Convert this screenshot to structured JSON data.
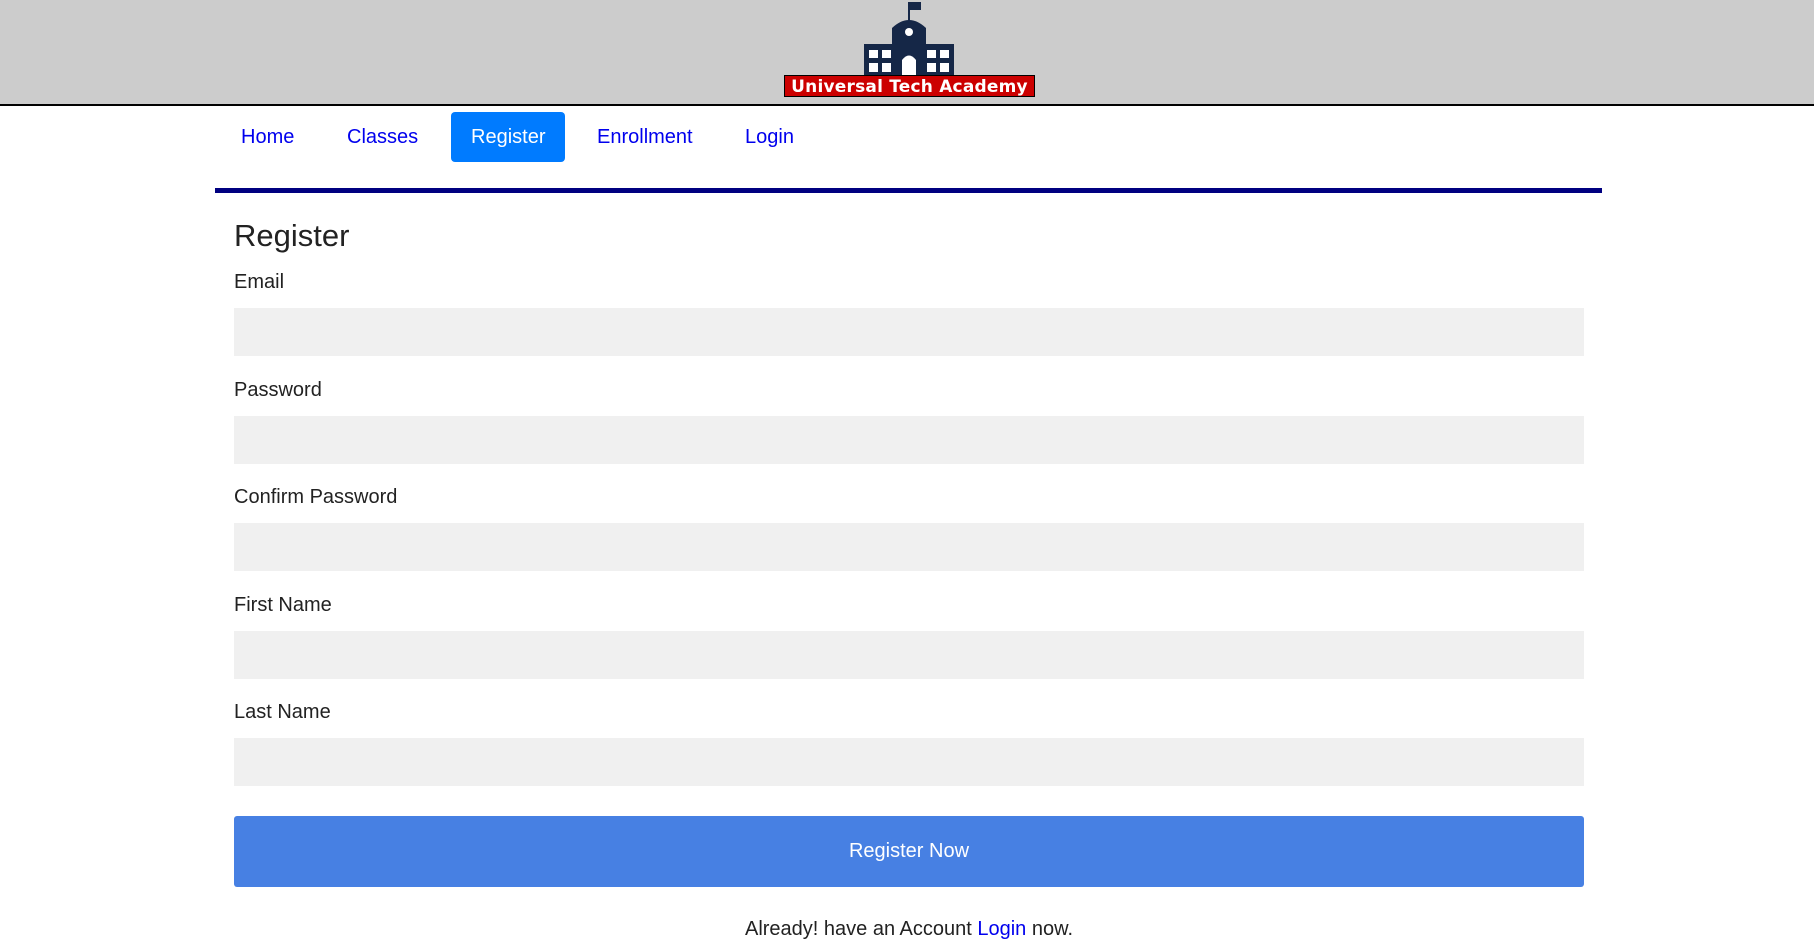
{
  "header": {
    "logo_text": "Universal Tech Academy",
    "logo_icon": "school-building-icon",
    "logo_icon_color": "#152747",
    "logo_banner_color": "#cc0000"
  },
  "nav": {
    "items": [
      {
        "label": "Home",
        "active": false
      },
      {
        "label": "Classes",
        "active": false
      },
      {
        "label": "Register",
        "active": true
      },
      {
        "label": "Enrollment",
        "active": false
      },
      {
        "label": "Login",
        "active": false
      }
    ],
    "active_color": "#007bff",
    "link_color": "#0000ee"
  },
  "form": {
    "title": "Register",
    "fields": [
      {
        "label": "Email",
        "value": "",
        "placeholder": ""
      },
      {
        "label": "Password",
        "value": "",
        "placeholder": ""
      },
      {
        "label": "Confirm Password",
        "value": "",
        "placeholder": ""
      },
      {
        "label": "First Name",
        "value": "",
        "placeholder": ""
      },
      {
        "label": "Last Name",
        "value": "",
        "placeholder": ""
      }
    ],
    "submit_label": "Register Now",
    "submit_color": "#4780e3"
  },
  "footer": {
    "prefix": "Already! have an Account ",
    "link_label": "Login",
    "suffix": " now."
  }
}
